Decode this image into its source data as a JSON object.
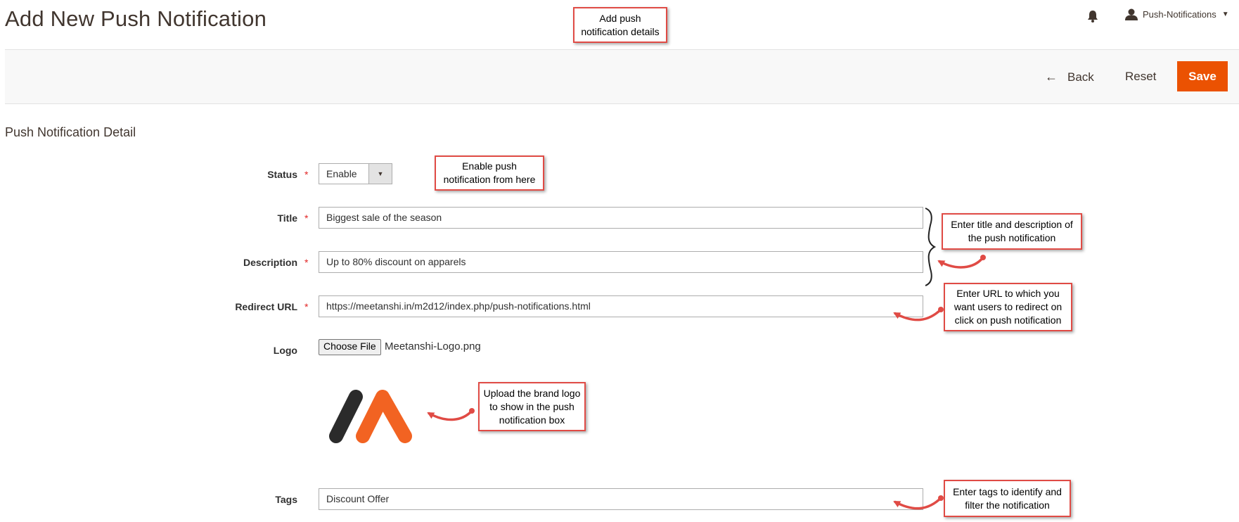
{
  "page": {
    "title": "Add New Push Notification"
  },
  "header": {
    "user_label": "Push-Notifications",
    "bell_icon": "bell-icon",
    "user_icon": "user-icon"
  },
  "actions": {
    "back_label": "Back",
    "reset_label": "Reset",
    "save_label": "Save",
    "save_color": "#eb5202"
  },
  "section": {
    "title": "Push Notification Detail"
  },
  "form": {
    "status": {
      "label": "Status",
      "value": "Enable"
    },
    "title": {
      "label": "Title",
      "value": "Biggest sale of the season"
    },
    "description": {
      "label": "Description",
      "value": "Up to 80% discount on apparels"
    },
    "redirect_url": {
      "label": "Redirect URL",
      "value": "https://meetanshi.in/m2d12/index.php/push-notifications.html"
    },
    "logo": {
      "label": "Logo",
      "button_label": "Choose File",
      "file_name": "Meetanshi-Logo.png"
    },
    "tags": {
      "label": "Tags",
      "value": "Discount Offer"
    },
    "required_marker": "*"
  },
  "callouts": {
    "add_details": "Add push notification details",
    "enable": "Enable push notification from here",
    "title_desc": "Enter title and description of the push notification",
    "redirect": "Enter URL to which you want users to redirect on click on push notification",
    "logo": "Upload the brand logo to show in the push notification box",
    "tags": "Enter tags to identify and filter the notification"
  },
  "colors": {
    "callout_border": "#e04b45",
    "required": "#e22626",
    "logo_dark": "#2b2b2b",
    "logo_orange": "#f26322"
  }
}
